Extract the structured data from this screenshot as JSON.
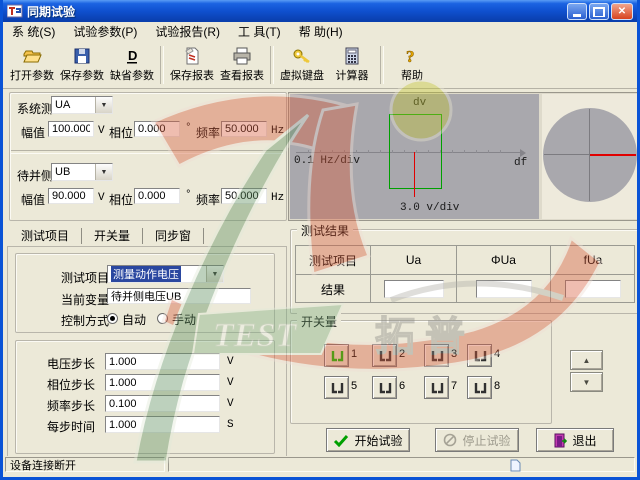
{
  "window": {
    "title": "同期试验"
  },
  "menu": {
    "items": [
      "系 统(S)",
      "试验参数(P)",
      "试验报告(R)",
      "工 具(T)",
      "帮 助(H)"
    ]
  },
  "toolbar": {
    "buttons": [
      {
        "label": "打开参数",
        "icon": "open-folder-icon"
      },
      {
        "label": "保存参数",
        "icon": "save-floppy-icon"
      },
      {
        "label": "缺省参数",
        "icon": "default-params-icon"
      },
      {
        "label": "保存报表",
        "icon": "save-report-icon"
      },
      {
        "label": "查看报表",
        "icon": "printer-icon"
      },
      {
        "label": "虚拟键盘",
        "icon": "key-icon"
      },
      {
        "label": "计算器",
        "icon": "calculator-icon"
      },
      {
        "label": "帮助",
        "icon": "help-icon"
      }
    ]
  },
  "signals": {
    "system": {
      "label": "系统测",
      "channel": "UA",
      "amp_label": "幅值",
      "amp": "100.000",
      "amp_unit": "V",
      "phase_label": "相位",
      "phase": "0.000",
      "phase_unit": "°",
      "freq_label": "频率",
      "freq": "50.000",
      "freq_unit": "Hz"
    },
    "standby": {
      "label": "待并侧",
      "channel": "UB",
      "amp_label": "幅值",
      "amp": "90.000",
      "amp_unit": "V",
      "phase_label": "相位",
      "phase": "0.000",
      "phase_unit": "°",
      "freq_label": "频率",
      "freq": "50.000",
      "freq_unit": "Hz"
    }
  },
  "tabs": {
    "items": [
      "测试项目",
      "开关量",
      "同步窗"
    ],
    "active": "测试项目"
  },
  "test_setup": {
    "item_label": "测试项目",
    "item_value": "测量动作电压",
    "variable_label": "当前变量",
    "variable_value": "待并侧电压UB",
    "control_label": "控制方式",
    "auto_label": "自动",
    "manual_label": "手动",
    "control_selected": "自动"
  },
  "steps": {
    "rows": [
      {
        "label": "电压步长",
        "value": "1.000",
        "unit": "V"
      },
      {
        "label": "相位步长",
        "value": "1.000",
        "unit": "V"
      },
      {
        "label": "频率步长",
        "value": "0.100",
        "unit": "V"
      },
      {
        "label": "每步时间",
        "value": "1.000",
        "unit": "S"
      }
    ]
  },
  "plot": {
    "dv_label": "dv",
    "df_label": "df",
    "x_scale": "0.1 Hz/div",
    "y_scale": "3.0 v/div"
  },
  "results": {
    "group_label": "测试结果",
    "item_header": "测试项目",
    "columns": [
      "Ua",
      "ΦUa",
      "fUa"
    ],
    "row_label": "结果",
    "values": [
      "",
      "",
      ""
    ]
  },
  "switches": {
    "group_label": "开关量",
    "items": [
      "1",
      "2",
      "3",
      "4",
      "5",
      "6",
      "7",
      "8"
    ],
    "active": "1"
  },
  "actions": {
    "start": "开始试验",
    "stop": "停止试验",
    "exit": "退出"
  },
  "status": {
    "text": "设备连接断开"
  },
  "watermark": {
    "en": "TEST",
    "cn": "拓 普"
  },
  "icons": {
    "combo_arrow": "▼",
    "spin_up": "▲",
    "spin_down": "▼"
  },
  "colors": {
    "title_blue": "#0a53d6",
    "sync_window_green": "#00a000",
    "marker_red": "#e00000",
    "selection_blue": "#2a47a0",
    "plot_gray": "#a9a8ad",
    "client_bg": "#ece9d8"
  }
}
